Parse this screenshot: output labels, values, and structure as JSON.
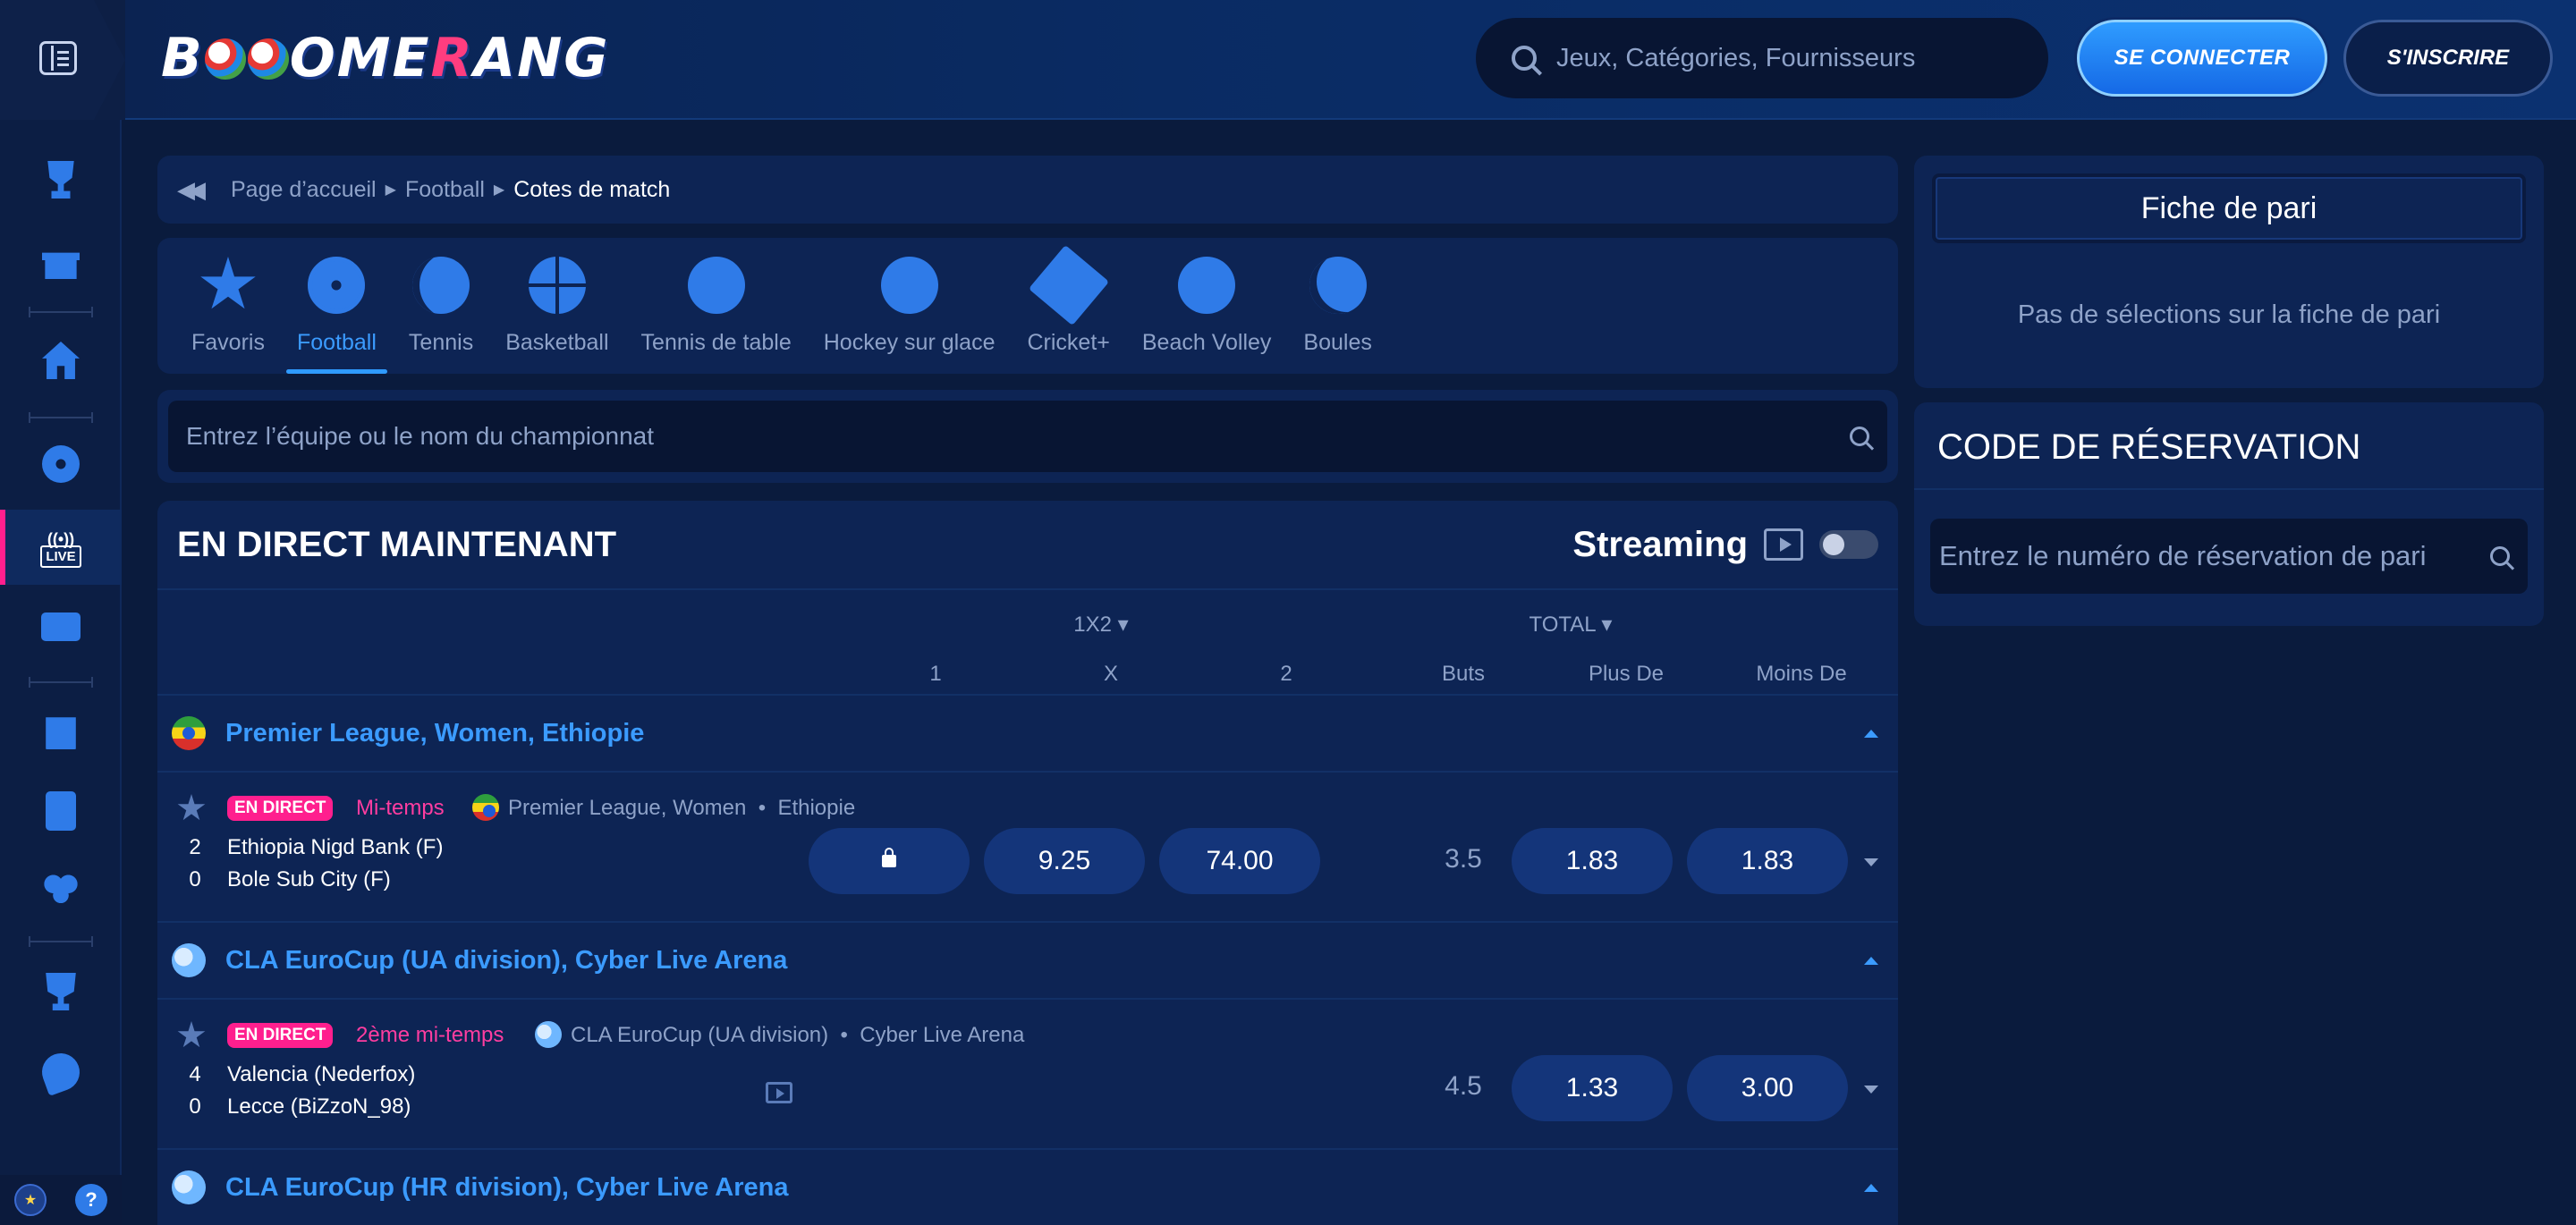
{
  "header": {
    "logo": {
      "text_pre": "B",
      "text_post": "OME",
      "text_r": "R",
      "text_end": "ANG",
      "alt": "BOOMERANG"
    },
    "search_placeholder": "Jeux, Catégories, Fournisseurs",
    "login_label": "SE CONNECTER",
    "register_label": "S'INSCRIRE"
  },
  "rail": {
    "live_label": "LIVE",
    "icons": [
      "trophy-icon",
      "gift-icon",
      "home-icon",
      "football-icon",
      "live-icon",
      "tv-sport-icon",
      "slot-machine-icon",
      "card-icon",
      "clover-icon",
      "cup-icon",
      "boomerang-icon"
    ],
    "help_label": "?"
  },
  "breadcrumb": {
    "items": [
      "Page d’accueil",
      "Football"
    ],
    "current": "Cotes de match"
  },
  "sports": [
    {
      "label": "Favoris",
      "icon": "star-icon",
      "active": false
    },
    {
      "label": "Football",
      "icon": "football-icon",
      "active": true
    },
    {
      "label": "Tennis",
      "icon": "tennis-icon",
      "active": false
    },
    {
      "label": "Basketball",
      "icon": "basketball-icon",
      "active": false
    },
    {
      "label": "Tennis de table",
      "icon": "table-tennis-icon",
      "active": false
    },
    {
      "label": "Hockey sur glace",
      "icon": "ice-hockey-icon",
      "active": false
    },
    {
      "label": "Cricket+",
      "icon": "cricket-icon",
      "active": false
    },
    {
      "label": "Beach Volley",
      "icon": "beach-volley-icon",
      "active": false
    },
    {
      "label": "Boules",
      "icon": "boules-icon",
      "active": false
    }
  ],
  "team_search": {
    "placeholder": "Entrez l’équipe ou le nom du championnat"
  },
  "live": {
    "title": "EN DIRECT MAINTENANT",
    "streaming_label": "Streaming",
    "markets": {
      "m1": "1X2",
      "m2": "TOTAL"
    },
    "columns": {
      "c1": "1",
      "cx": "X",
      "c2": "2",
      "buts": "Buts",
      "plus": "Plus De",
      "moins": "Moins De"
    },
    "leagues": [
      {
        "name": "Premier League, Women, Ethiopie",
        "match": {
          "badge": "EN DIRECT",
          "status": "Mi-temps",
          "league": "Premier League, Women",
          "country": "Ethiopie",
          "home_score": "2",
          "home": "Ethiopia Nigd Bank (F)",
          "away_score": "0",
          "away": "Bole Sub City (F)",
          "odd_1_locked": true,
          "odd_x": "9.25",
          "odd_2": "74.00",
          "total": "3.5",
          "over": "1.83",
          "under": "1.83"
        }
      },
      {
        "name": "CLA EuroCup (UA division), Cyber Live Arena",
        "match": {
          "badge": "EN DIRECT",
          "status": "2ème mi-temps",
          "league": "CLA EuroCup (UA division)",
          "country": "Cyber Live Arena",
          "home_score": "4",
          "home": "Valencia (Nederfox)",
          "away_score": "0",
          "away": "Lecce (BiZzoN_98)",
          "total": "4.5",
          "over": "1.33",
          "under": "3.00"
        }
      },
      {
        "name": "CLA EuroCup (HR division), Cyber Live Arena"
      }
    ]
  },
  "betslip": {
    "title": "Fiche de pari",
    "empty": "Pas de sélections sur la fiche de pari"
  },
  "booking": {
    "title": "CODE DE RÉSERVATION",
    "placeholder": "Entrez le numéro de réservation de pari"
  },
  "colors": {
    "background": "#0a1b3d",
    "panel": "#0d2454",
    "accent": "#2f7be8",
    "live": "#ff1f8e",
    "muted": "#8ea2c8"
  }
}
